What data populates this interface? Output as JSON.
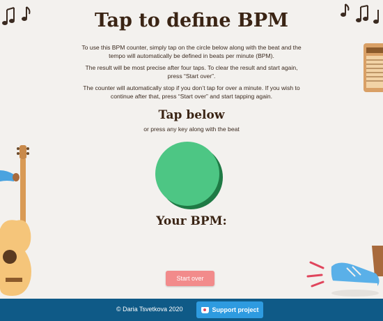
{
  "page": {
    "title": "Tap to define BPM",
    "intro": [
      "To use this BPM counter, simply tap on the circle below along with the beat and the tempo will automatically be defined in beats per minute (BPM).",
      "The result will be most precise after four taps. To clear the result and start again, press “Start over”.",
      "The counter will automatically stop if you don’t tap for over a minute. If you wish to continue after that, press “Start over” and start tapping again."
    ]
  },
  "tapper": {
    "heading": "Tap below",
    "subtext": "or press any key along with the beat",
    "circle_color": "#4dc684"
  },
  "result": {
    "label": "Your BPM:",
    "value": ""
  },
  "actions": {
    "start_over": "Start over"
  },
  "footer": {
    "copyright": "© Daria Tsvetkova 2020",
    "support": "Support project",
    "background": "#0f5a87"
  },
  "decorations": {
    "music-notes-left": "music-notes-icon",
    "music-notes-right": "music-notes-icon",
    "amplifier": "amplifier-icon",
    "guitar": "guitar-icon",
    "foot": "tapping-foot-icon"
  }
}
